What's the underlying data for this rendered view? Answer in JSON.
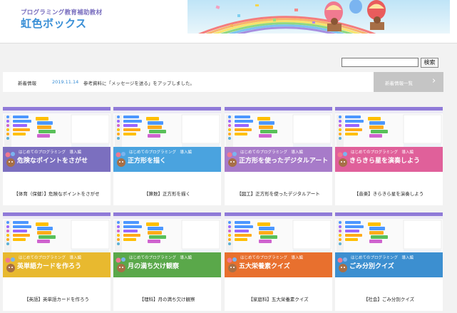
{
  "header": {
    "logo_subtitle": "プログラミング教育補助教材",
    "logo_title": "虹色ボックス"
  },
  "search": {
    "value": "",
    "button_label": "検索"
  },
  "news": {
    "label": "新着情報",
    "date": "2019.11.14",
    "text": "参考資料に「メッセージを送る」をアップしました。",
    "list_button_label": "新着情報一覧",
    "chevron": "›"
  },
  "cards": [
    {
      "sub": "はじめてのプログラミング　導入編",
      "title": "危険なポイントをさがせ",
      "caption": "【体育（保健）】危険なポイントをさがせ",
      "color": "#7b6fbf"
    },
    {
      "sub": "はじめてのプログラミング　導入編",
      "title": "正方形を描く",
      "caption": "【算数】正方形を描く",
      "color": "#4aa3df"
    },
    {
      "sub": "はじめてのプログラミング　導入編",
      "title": "正方形を使ったデジタルアート",
      "caption": "【図工】正方形を使ったデジタルアート",
      "color": "#a77bc9"
    },
    {
      "sub": "はじめてのプログラミング　導入編",
      "title": "きらきら星を演奏しよう",
      "caption": "【音楽】きらきら星を演奏しよう",
      "color": "#e0609a"
    },
    {
      "sub": "はじめてのプログラミング　導入編",
      "title": "英単語カードを作ろう",
      "caption": "【英語】英単語カードを作ろう",
      "color": "#e8b92f"
    },
    {
      "sub": "はじめてのプログラミング　導入編",
      "title": "月の満ち欠け観察",
      "caption": "【理科】月の満ち欠け観察",
      "color": "#5aa84a"
    },
    {
      "sub": "はじめてのプログラミング　導入編",
      "title": "五大栄養素クイズ",
      "caption": "【家庭科】五大栄養素クイズ",
      "color": "#e8702e"
    },
    {
      "sub": "はじめてのプログラミング　導入編",
      "title": "ごみ分別クイズ",
      "caption": "【社会】ごみ分別クイズ",
      "color": "#3c8fd0"
    }
  ]
}
